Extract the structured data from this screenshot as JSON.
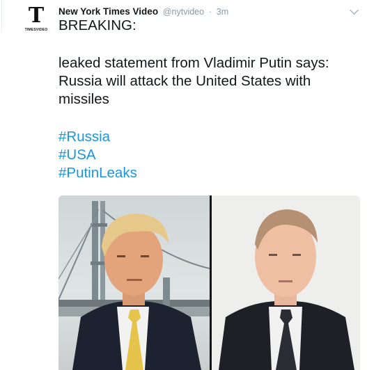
{
  "tweet": {
    "author_name": "New York Times Video",
    "handle": "@nytvideo",
    "separator": "·",
    "time": "3m",
    "avatar": {
      "logo_glyph": "T",
      "logo_sub": "TIMESVIDEO"
    },
    "text_line1": "BREAKING:",
    "text_para2": "leaked statement from Vladimir Putin says: Russia will attack the United States with missiles",
    "hashtags": [
      "#Russia",
      "#USA",
      "#PutinLeaks"
    ],
    "colors": {
      "link": "#1b95e0",
      "meta": "#8899a6",
      "text": "#14171a"
    },
    "media": {
      "left_photo_icon": "portrait-photo-left",
      "right_photo_icon": "portrait-photo-right"
    }
  }
}
